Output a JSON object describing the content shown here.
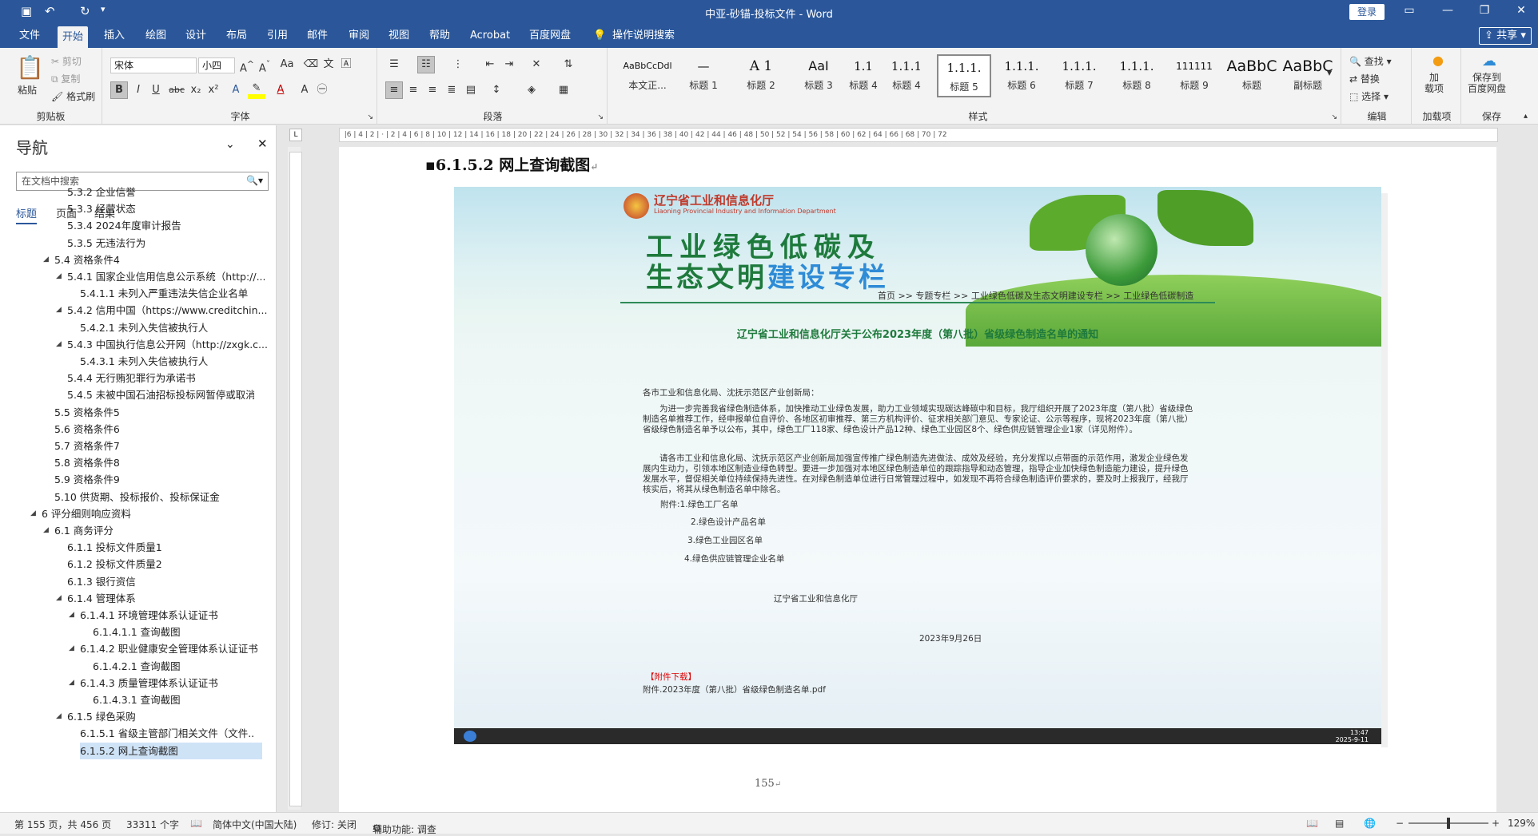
{
  "window": {
    "title": "中亚-砂锚-投标文件 - Word",
    "login": "登录"
  },
  "tabs": [
    {
      "label": "文件"
    },
    {
      "label": "开始"
    },
    {
      "label": "插入"
    },
    {
      "label": "绘图"
    },
    {
      "label": "设计"
    },
    {
      "label": "布局"
    },
    {
      "label": "引用"
    },
    {
      "label": "邮件"
    },
    {
      "label": "审阅"
    },
    {
      "label": "视图"
    },
    {
      "label": "帮助"
    },
    {
      "label": "Acrobat"
    },
    {
      "label": "百度网盘"
    },
    {
      "label": "操作说明搜索"
    }
  ],
  "share": "共享",
  "ribbon": {
    "clipboard": {
      "label": "剪贴板",
      "paste": "粘贴",
      "cut": "剪切",
      "copy": "复制",
      "format_painter": "格式刷"
    },
    "font": {
      "label": "字体",
      "name": "宋体",
      "size": "小四"
    },
    "paragraph": {
      "label": "段落"
    },
    "styles": {
      "label": "样式",
      "items": [
        {
          "preview": "AaBbCcDdl",
          "name": "本文正..."
        },
        {
          "preview": "—",
          "name": "标题 1"
        },
        {
          "preview": "A 1",
          "name": "标题 2"
        },
        {
          "preview": "AaI",
          "name": "标题 3"
        },
        {
          "preview": "1.1",
          "name": "标题 4"
        },
        {
          "preview": "1.1.1",
          "name": "标题 4"
        },
        {
          "preview": "1.1.1.",
          "name": "标题 5"
        },
        {
          "preview": "1.1.1.",
          "name": "标题 6"
        },
        {
          "preview": "1.1.1.",
          "name": "标题 7"
        },
        {
          "preview": "1.1.1.",
          "name": "标题 8"
        },
        {
          "preview": "111111",
          "name": "标题 9"
        },
        {
          "preview": "AaBbC",
          "name": "标题"
        },
        {
          "preview": "AaBbC",
          "name": "副标题"
        }
      ]
    },
    "editing": {
      "label": "编辑",
      "find": "查找",
      "replace": "替换",
      "select": "选择"
    },
    "addins": {
      "label": "加载项",
      "btn": "加\n载项"
    },
    "save": {
      "label": "保存",
      "btn": "保存到\n百度网盘"
    }
  },
  "nav": {
    "title": "导航",
    "search_placeholder": "在文档中搜索",
    "tabs": [
      "标题",
      "页面",
      "结果"
    ],
    "items": [
      {
        "text": "5.3.2 企业信誉",
        "level": 3,
        "tri": ""
      },
      {
        "text": "5.3.3 经营状态",
        "level": 3,
        "tri": ""
      },
      {
        "text": "5.3.4 2024年度审计报告",
        "level": 3,
        "tri": ""
      },
      {
        "text": "5.3.5 无违法行为",
        "level": 3,
        "tri": ""
      },
      {
        "text": "5.4 资格条件4",
        "level": 2,
        "tri": "◢"
      },
      {
        "text": "5.4.1 国家企业信用信息公示系统（http://...",
        "level": 3,
        "tri": "◢"
      },
      {
        "text": "5.4.1.1 未列入严重违法失信企业名单",
        "level": 4,
        "tri": ""
      },
      {
        "text": "5.4.2 信用中国（https://www.creditchin...",
        "level": 3,
        "tri": "◢"
      },
      {
        "text": "5.4.2.1 未列入失信被执行人",
        "level": 4,
        "tri": ""
      },
      {
        "text": "5.4.3 中国执行信息公开网（http://zxgk.c...",
        "level": 3,
        "tri": "◢"
      },
      {
        "text": "5.4.3.1 未列入失信被执行人",
        "level": 4,
        "tri": ""
      },
      {
        "text": "5.4.4 无行贿犯罪行为承诺书",
        "level": 3,
        "tri": ""
      },
      {
        "text": "5.4.5 未被中国石油招标投标网暂停或取消...",
        "level": 3,
        "tri": ""
      },
      {
        "text": "5.5 资格条件5",
        "level": 2,
        "tri": ""
      },
      {
        "text": "5.6 资格条件6",
        "level": 2,
        "tri": ""
      },
      {
        "text": "5.7 资格条件7",
        "level": 2,
        "tri": ""
      },
      {
        "text": "5.8 资格条件8",
        "level": 2,
        "tri": ""
      },
      {
        "text": "5.9 资格条件9",
        "level": 2,
        "tri": ""
      },
      {
        "text": "5.10 供货期、投标报价、投标保证金",
        "level": 2,
        "tri": ""
      },
      {
        "text": "6 评分细则响应资料",
        "level": 1,
        "tri": "◢"
      },
      {
        "text": "6.1 商务评分",
        "level": 2,
        "tri": "◢"
      },
      {
        "text": "6.1.1 投标文件质量1",
        "level": 3,
        "tri": ""
      },
      {
        "text": "6.1.2 投标文件质量2",
        "level": 3,
        "tri": ""
      },
      {
        "text": "6.1.3 银行资信",
        "level": 3,
        "tri": ""
      },
      {
        "text": "6.1.4 管理体系",
        "level": 3,
        "tri": "◢"
      },
      {
        "text": "6.1.4.1 环境管理体系认证证书",
        "level": 4,
        "tri": "◢"
      },
      {
        "text": "6.1.4.1.1 查询截图",
        "level": 5,
        "tri": ""
      },
      {
        "text": "6.1.4.2 职业健康安全管理体系认证证书",
        "level": 4,
        "tri": "◢"
      },
      {
        "text": "6.1.4.2.1 查询截图",
        "level": 5,
        "tri": ""
      },
      {
        "text": "6.1.4.3 质量管理体系认证证书",
        "level": 4,
        "tri": "◢"
      },
      {
        "text": "6.1.4.3.1 查询截图",
        "level": 5,
        "tri": ""
      },
      {
        "text": "6.1.5 绿色采购",
        "level": 3,
        "tri": "◢"
      },
      {
        "text": "6.1.5.1 省级主管部门相关文件（文件...",
        "level": 4,
        "tri": ""
      },
      {
        "text": "6.1.5.2 网上查询截图",
        "level": 4,
        "tri": "",
        "selected": true
      }
    ]
  },
  "doc": {
    "heading": "6.1.5.2 网上查询截图",
    "page_number": "155",
    "screenshot": {
      "gov_name": "辽宁省工业和信息化厅",
      "gov_en": "Liaoning Provincial Industry and Information Department",
      "banner_line1": "工业绿色低碳及",
      "banner_line2a": "生态文明",
      "banner_line2b": "建设专栏",
      "breadcrumb": "首页 >> 专题专栏 >> 工业绿色低碳及生态文明建设专栏 >> 工业绿色低碳制造",
      "notice_title": "辽宁省工业和信息化厅关于公布2023年度（第八批）省级绿色制造名单的通知",
      "salutation": "各市工业和信息化局、沈抚示范区产业创新局：",
      "para1": "为进一步完善我省绿色制造体系，加快推动工业绿色发展，助力工业领域实现碳达峰碳中和目标，我厅组织开展了2023年度（第八批）省级绿色制造名单推荐工作，经申报单位自评价、各地区初审推荐、第三方机构评价、征求相关部门意见、专家论证、公示等程序，现将2023年度（第八批）省级绿色制造名单予以公布，其中，绿色工厂118家、绿色设计产品12种、绿色工业园区8个、绿色供应链管理企业1家（详见附件）。",
      "para2": "请各市工业和信息化局、沈抚示范区产业创新局加强宣传推广绿色制造先进做法、成效及经验，充分发挥以点带面的示范作用，激发企业绿色发展内生动力，引领本地区制造业绿色转型。要进一步加强对本地区绿色制造单位的跟踪指导和动态管理，指导企业加快绿色制造能力建设，提升绿色发展水平，督促相关单位持续保持先进性。在对绿色制造单位进行日常管理过程中，如发现不再符合绿色制造评价要求的，要及时上报我厅，经我厅核实后，将其从绿色制造名单中除名。",
      "attach1": "附件:1.绿色工厂名单",
      "attach2": "2.绿色设计产品名单",
      "attach3": "3.绿色工业园区名单",
      "attach4": "4.绿色供应链管理企业名单",
      "signer": "辽宁省工业和信息化厅",
      "date": "2023年9月26日",
      "download_label": "【附件下载】",
      "download_file": "附件.2023年度（第八批）省级绿色制造名单.pdf",
      "clock_time": "13:47",
      "clock_date": "2025-9-11"
    }
  },
  "status": {
    "page": "第 155 页，共 456 页",
    "words": "33311 个字",
    "language": "简体中文(中国大陆)",
    "track": "修订: 关闭",
    "accessibility": "辅助功能: 调查",
    "zoom": "129%"
  },
  "colors": {
    "brand": "#2b579a",
    "banner_green": "#1e7a3c",
    "accent_blue": "#2e8bd6"
  }
}
